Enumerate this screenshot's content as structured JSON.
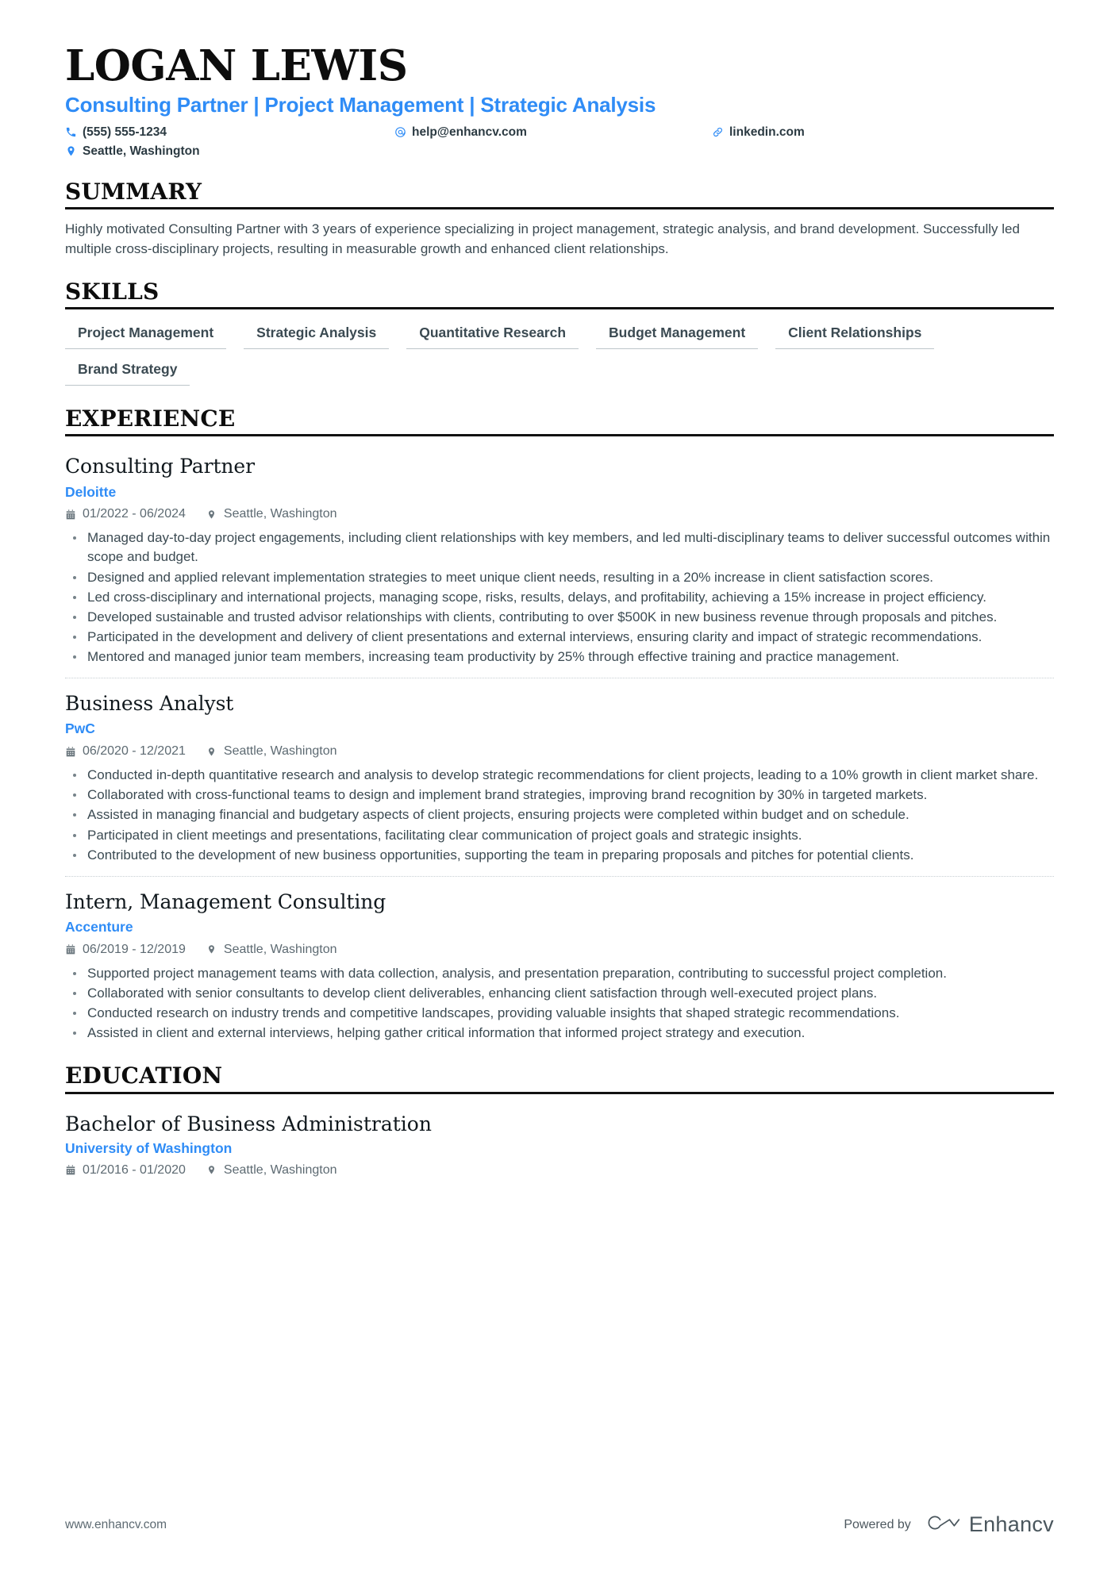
{
  "header": {
    "name": "LOGAN LEWIS",
    "headline": "Consulting Partner | Project Management | Strategic Analysis",
    "contacts": [
      {
        "icon": "phone-icon",
        "text": "(555) 555-1234"
      },
      {
        "icon": "email-icon",
        "text": "help@enhancv.com"
      },
      {
        "icon": "link-icon",
        "text": "linkedin.com"
      },
      {
        "icon": "location-icon",
        "text": "Seattle, Washington"
      }
    ]
  },
  "summary": {
    "title": "SUMMARY",
    "text": "Highly motivated Consulting Partner with 3 years of experience specializing in project management, strategic analysis, and brand development. Successfully led multiple cross-disciplinary projects, resulting in measurable growth and enhanced client relationships."
  },
  "skills": {
    "title": "SKILLS",
    "items": [
      "Project Management",
      "Strategic Analysis",
      "Quantitative Research",
      "Budget Management",
      "Client Relationships",
      "Brand Strategy"
    ]
  },
  "experience": {
    "title": "EXPERIENCE",
    "entries": [
      {
        "role": "Consulting Partner",
        "company": "Deloitte",
        "dates": "01/2022 - 06/2024",
        "location": "Seattle, Washington",
        "bullets": [
          "Managed day-to-day project engagements, including client relationships with key members, and led multi-disciplinary teams to deliver successful outcomes within scope and budget.",
          "Designed and applied relevant implementation strategies to meet unique client needs, resulting in a 20% increase in client satisfaction scores.",
          "Led cross-disciplinary and international projects, managing scope, risks, results, delays, and profitability, achieving a 15% increase in project efficiency.",
          "Developed sustainable and trusted advisor relationships with clients, contributing to over $500K in new business revenue through proposals and pitches.",
          "Participated in the development and delivery of client presentations and external interviews, ensuring clarity and impact of strategic recommendations.",
          "Mentored and managed junior team members, increasing team productivity by 25% through effective training and practice management."
        ]
      },
      {
        "role": "Business Analyst",
        "company": "PwC",
        "dates": "06/2020 - 12/2021",
        "location": "Seattle, Washington",
        "bullets": [
          "Conducted in-depth quantitative research and analysis to develop strategic recommendations for client projects, leading to a 10% growth in client market share.",
          "Collaborated with cross-functional teams to design and implement brand strategies, improving brand recognition by 30% in targeted markets.",
          "Assisted in managing financial and budgetary aspects of client projects, ensuring projects were completed within budget and on schedule.",
          "Participated in client meetings and presentations, facilitating clear communication of project goals and strategic insights.",
          "Contributed to the development of new business opportunities, supporting the team in preparing proposals and pitches for potential clients."
        ]
      },
      {
        "role": "Intern, Management Consulting",
        "company": "Accenture",
        "dates": "06/2019 - 12/2019",
        "location": "Seattle, Washington",
        "bullets": [
          "Supported project management teams with data collection, analysis, and presentation preparation, contributing to successful project completion.",
          "Collaborated with senior consultants to develop client deliverables, enhancing client satisfaction through well-executed project plans.",
          "Conducted research on industry trends and competitive landscapes, providing valuable insights that shaped strategic recommendations.",
          "Assisted in client and external interviews, helping gather critical information that informed project strategy and execution."
        ]
      }
    ]
  },
  "education": {
    "title": "EDUCATION",
    "entries": [
      {
        "degree": "Bachelor of Business Administration",
        "school": "University of Washington",
        "dates": "01/2016 - 01/2020",
        "location": "Seattle, Washington"
      }
    ]
  },
  "footer": {
    "url": "www.enhancv.com",
    "powered_by": "Powered by",
    "brand": "Enhancv"
  },
  "colors": {
    "accent": "#2f8cf6",
    "text": "#3b4a52",
    "heading": "#0d0d0d",
    "muted": "#5d6a72"
  }
}
